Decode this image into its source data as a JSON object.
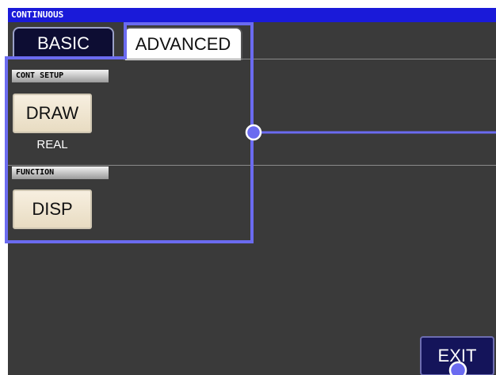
{
  "window": {
    "title": "CONTINUOUS"
  },
  "tabs": [
    {
      "label": "BASIC",
      "active": false
    },
    {
      "label": "ADVANCED",
      "active": true
    }
  ],
  "sections": {
    "cont_setup": {
      "label": "CONT SETUP",
      "button_label": "DRAW",
      "value": "REAL"
    },
    "function": {
      "label": "FUNCTION",
      "button_label": "DISP"
    }
  },
  "footer": {
    "exit_label": "EXIT"
  },
  "colors": {
    "titlebar": "#1a1ad9",
    "background": "#3a3a3a",
    "highlight": "#6b6bf0",
    "button": "#f7efe0",
    "exit_button": "#14145a"
  }
}
